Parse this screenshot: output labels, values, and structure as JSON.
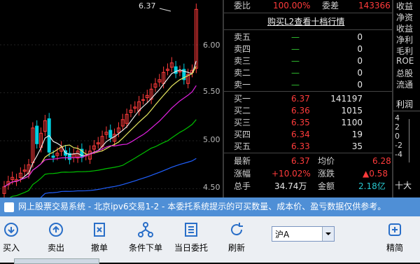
{
  "chart": {
    "price_labels": [
      "6.00",
      "5.50",
      "5.00",
      "4.50"
    ],
    "high_label": "6.37",
    "colors": {
      "up": "#ff3b3b",
      "down": "#00d0e0",
      "ma5": "#e8e8e8",
      "ma10": "#e8e860",
      "ma20": "#e020e0",
      "ma30": "#00c000",
      "ma60": "#2060ff"
    }
  },
  "quote": {
    "top": {
      "weibi_label": "委比",
      "weibi_value": "100.00%",
      "weicha_label": "委差",
      "weicha_value": "143366"
    },
    "l2_link": "购买L2查看十档行情",
    "sells": [
      {
        "label": "卖五",
        "price": "—",
        "vol": "0"
      },
      {
        "label": "卖四",
        "price": "—",
        "vol": "0"
      },
      {
        "label": "卖三",
        "price": "—",
        "vol": "0"
      },
      {
        "label": "卖二",
        "price": "—",
        "vol": "0"
      },
      {
        "label": "卖一",
        "price": "—",
        "vol": "0"
      }
    ],
    "buys": [
      {
        "label": "买一",
        "price": "6.37",
        "vol": "141197"
      },
      {
        "label": "买二",
        "price": "6.36",
        "vol": "1015"
      },
      {
        "label": "买三",
        "price": "6.35",
        "vol": "1100"
      },
      {
        "label": "买四",
        "price": "6.34",
        "vol": "19"
      },
      {
        "label": "买五",
        "price": "6.33",
        "vol": "35"
      }
    ],
    "summary": {
      "latest_label": "最新",
      "latest": "6.37",
      "avg_label": "均价",
      "avg": "6.28",
      "chg_pct_label": "涨幅",
      "chg_pct": "+10.02%",
      "chg_label": "涨跌",
      "chg": "▲0.58",
      "vol_label": "总手",
      "vol": "34.74万",
      "amt_label": "金额",
      "amt": "2.18亿"
    }
  },
  "fin": {
    "rows": [
      "收益",
      "净资",
      "收益",
      "净利",
      "毛利",
      "ROE",
      "总股",
      "流通"
    ],
    "profit_title": "利润",
    "axis": [
      "4",
      "2",
      "0",
      "-2",
      "-4"
    ],
    "bottom": "十大"
  },
  "banner": "网上股票交易系统 - 北京ipv6交易1-2 - 本委托系统提示的可买数量、成本价、盈亏数据仅供参考。",
  "toolbar": {
    "buy": "买入",
    "sell": "卖出",
    "cancel": "撤单",
    "condition": "条件下单",
    "today": "当日委托",
    "refresh": "刷新",
    "market": "沪A",
    "simple": "精简"
  }
}
